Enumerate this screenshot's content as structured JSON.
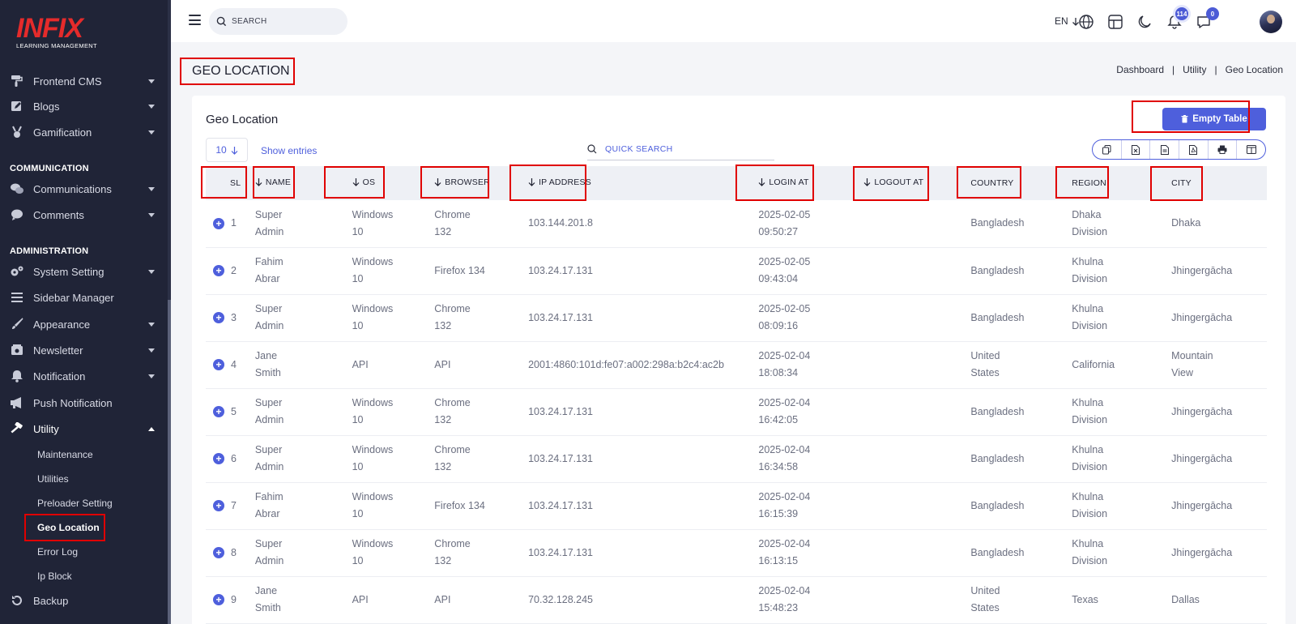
{
  "brand": {
    "logo_text": "INFIX",
    "logo_sub": "LEARNING MANAGEMENT",
    "accent": "#4e5fdc",
    "logo_color": "#e52b2b"
  },
  "sidebar": {
    "items_top": [
      {
        "label": "Frontend CMS",
        "icon": "paint-roller-icon"
      },
      {
        "label": "Blogs",
        "icon": "edit-square-icon"
      },
      {
        "label": "Gamification",
        "icon": "medal-icon"
      }
    ],
    "section_communication": "COMMUNICATION",
    "items_comm": [
      {
        "label": "Communications",
        "icon": "comments-icon"
      },
      {
        "label": "Comments",
        "icon": "comment-icon"
      }
    ],
    "section_admin": "ADMINISTRATION",
    "items_admin": [
      {
        "label": "System Setting",
        "icon": "gears-icon"
      },
      {
        "label": "Sidebar Manager",
        "icon": "bars-icon"
      },
      {
        "label": "Appearance",
        "icon": "brush-icon"
      },
      {
        "label": "Newsletter",
        "icon": "newsletter-icon"
      },
      {
        "label": "Notification",
        "icon": "bell-icon"
      },
      {
        "label": "Push Notification",
        "icon": "megaphone-icon"
      },
      {
        "label": "Utility",
        "icon": "hammer-icon"
      }
    ],
    "utility_sub": [
      "Maintenance",
      "Utilities",
      "Preloader Setting",
      "Geo Location",
      "Error Log",
      "Ip Block"
    ],
    "bottom_item": {
      "label": "Backup",
      "icon": "backup-icon"
    }
  },
  "header": {
    "search_placeholder": "SEARCH",
    "lang": "EN",
    "notification_count": "114",
    "message_count": "0"
  },
  "page": {
    "title": "GEO LOCATION",
    "breadcrumb": [
      "Dashboard",
      "Utility",
      "Geo Location"
    ]
  },
  "card": {
    "title": "Geo Location",
    "empty_button": "Empty Table",
    "entries_value": "10",
    "show_entries": "Show entries",
    "quick_search_placeholder": "QUICK SEARCH",
    "export_icons": [
      "copy-icon",
      "excel-icon",
      "csv-icon",
      "pdf-icon",
      "print-icon",
      "columns-icon"
    ]
  },
  "table": {
    "columns": [
      "SL",
      "NAME",
      "OS",
      "BROWSER",
      "IP ADDRESS",
      "LOGIN AT",
      "LOGOUT AT",
      "COUNTRY",
      "REGION",
      "CITY"
    ],
    "sortable": [
      false,
      true,
      true,
      true,
      true,
      true,
      true,
      false,
      false,
      false
    ],
    "rows": [
      {
        "sl": "1",
        "name": [
          "Super",
          "Admin"
        ],
        "os": [
          "Windows",
          "10"
        ],
        "browser": [
          "Chrome",
          "132"
        ],
        "ip": "103.144.201.8",
        "login": [
          "2025-02-05",
          "09:50:27"
        ],
        "logout": "",
        "country": [
          "Bangladesh"
        ],
        "region": [
          "Dhaka",
          "Division"
        ],
        "city": [
          "Dhaka"
        ]
      },
      {
        "sl": "2",
        "name": [
          "Fahim",
          "Abrar"
        ],
        "os": [
          "Windows",
          "10"
        ],
        "browser": [
          "Firefox 134"
        ],
        "ip": "103.24.17.131",
        "login": [
          "2025-02-05",
          "09:43:04"
        ],
        "logout": "",
        "country": [
          "Bangladesh"
        ],
        "region": [
          "Khulna",
          "Division"
        ],
        "city": [
          "Jhingergācha"
        ]
      },
      {
        "sl": "3",
        "name": [
          "Super",
          "Admin"
        ],
        "os": [
          "Windows",
          "10"
        ],
        "browser": [
          "Chrome",
          "132"
        ],
        "ip": "103.24.17.131",
        "login": [
          "2025-02-05",
          "08:09:16"
        ],
        "logout": "",
        "country": [
          "Bangladesh"
        ],
        "region": [
          "Khulna",
          "Division"
        ],
        "city": [
          "Jhingergācha"
        ]
      },
      {
        "sl": "4",
        "name": [
          "Jane",
          "Smith"
        ],
        "os": [
          "API"
        ],
        "browser": [
          "API"
        ],
        "ip": "2001:4860:101d:fe07:a002:298a:b2c4:ac2b",
        "login": [
          "2025-02-04",
          "18:08:34"
        ],
        "logout": "",
        "country": [
          "United",
          "States"
        ],
        "region": [
          "California"
        ],
        "city": [
          "Mountain",
          "View"
        ]
      },
      {
        "sl": "5",
        "name": [
          "Super",
          "Admin"
        ],
        "os": [
          "Windows",
          "10"
        ],
        "browser": [
          "Chrome",
          "132"
        ],
        "ip": "103.24.17.131",
        "login": [
          "2025-02-04",
          "16:42:05"
        ],
        "logout": "",
        "country": [
          "Bangladesh"
        ],
        "region": [
          "Khulna",
          "Division"
        ],
        "city": [
          "Jhingergācha"
        ]
      },
      {
        "sl": "6",
        "name": [
          "Super",
          "Admin"
        ],
        "os": [
          "Windows",
          "10"
        ],
        "browser": [
          "Chrome",
          "132"
        ],
        "ip": "103.24.17.131",
        "login": [
          "2025-02-04",
          "16:34:58"
        ],
        "logout": "",
        "country": [
          "Bangladesh"
        ],
        "region": [
          "Khulna",
          "Division"
        ],
        "city": [
          "Jhingergācha"
        ]
      },
      {
        "sl": "7",
        "name": [
          "Fahim",
          "Abrar"
        ],
        "os": [
          "Windows",
          "10"
        ],
        "browser": [
          "Firefox 134"
        ],
        "ip": "103.24.17.131",
        "login": [
          "2025-02-04",
          "16:15:39"
        ],
        "logout": "",
        "country": [
          "Bangladesh"
        ],
        "region": [
          "Khulna",
          "Division"
        ],
        "city": [
          "Jhingergācha"
        ]
      },
      {
        "sl": "8",
        "name": [
          "Super",
          "Admin"
        ],
        "os": [
          "Windows",
          "10"
        ],
        "browser": [
          "Chrome",
          "132"
        ],
        "ip": "103.24.17.131",
        "login": [
          "2025-02-04",
          "16:13:15"
        ],
        "logout": "",
        "country": [
          "Bangladesh"
        ],
        "region": [
          "Khulna",
          "Division"
        ],
        "city": [
          "Jhingergācha"
        ]
      },
      {
        "sl": "9",
        "name": [
          "Jane",
          "Smith"
        ],
        "os": [
          "API"
        ],
        "browser": [
          "API"
        ],
        "ip": "70.32.128.245",
        "login": [
          "2025-02-04",
          "15:48:23"
        ],
        "logout": "",
        "country": [
          "United",
          "States"
        ],
        "region": [
          "Texas"
        ],
        "city": [
          "Dallas"
        ]
      }
    ]
  }
}
